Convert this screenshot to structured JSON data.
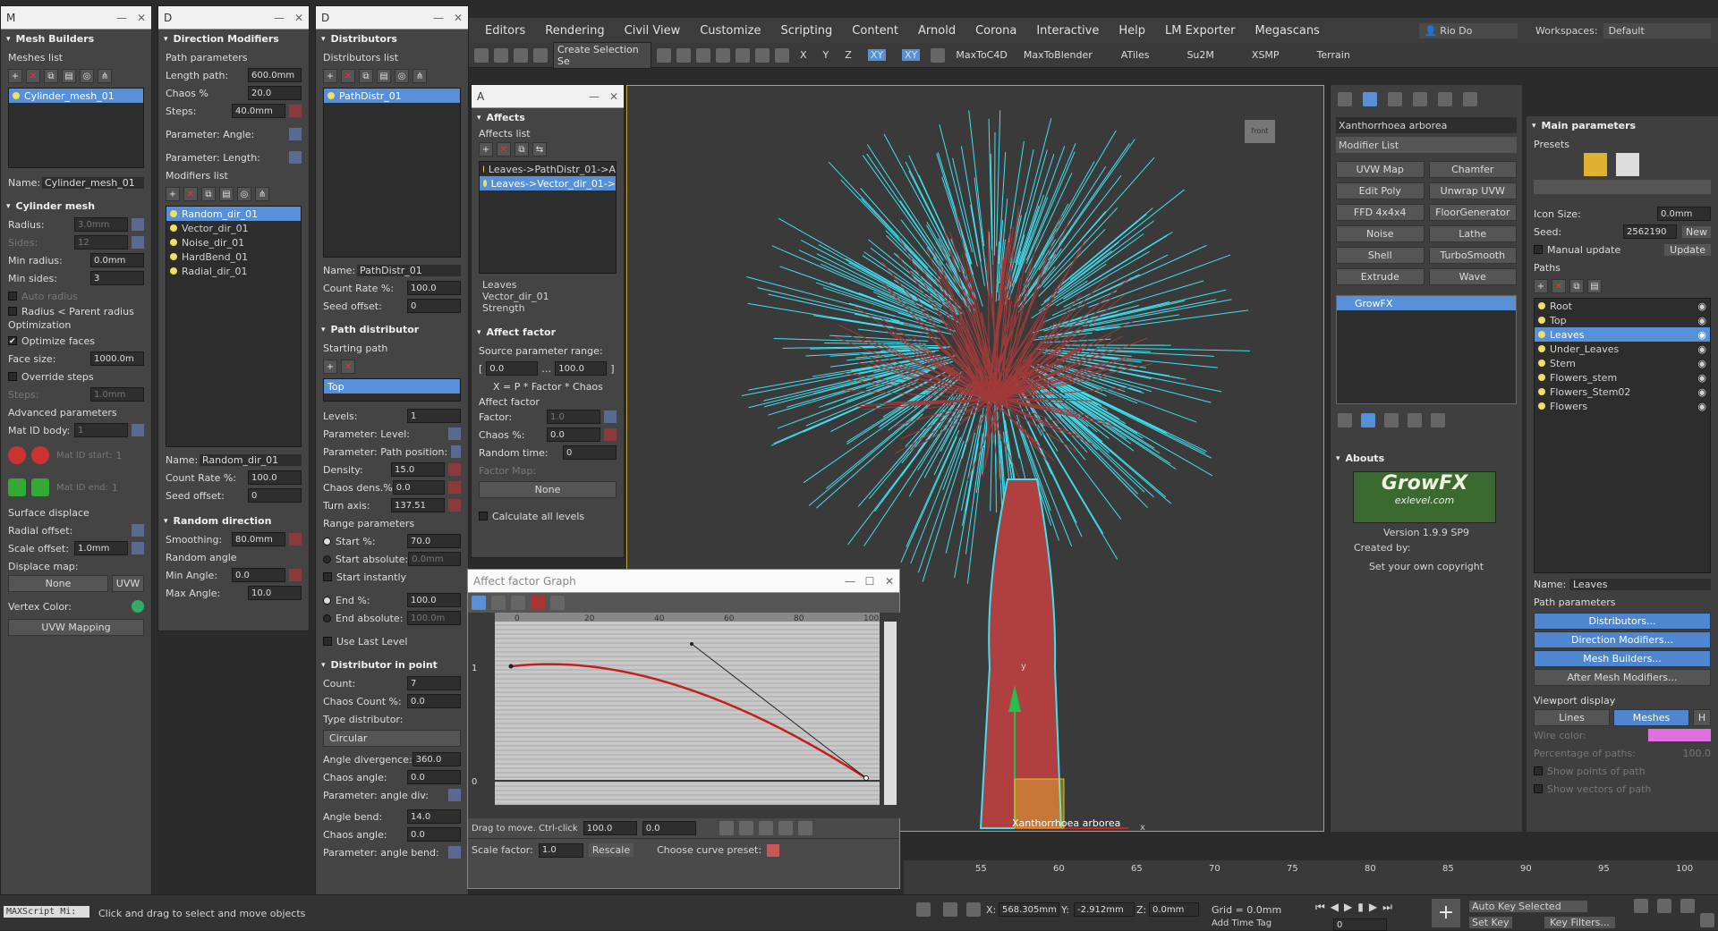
{
  "menu": {
    "items": [
      "Editors",
      "Rendering",
      "Civil View",
      "Customize",
      "Scripting",
      "Content",
      "Arnold",
      "Corona",
      "Interactive",
      "Help",
      "LM Exporter",
      "Megascans"
    ],
    "user": "Rio Do",
    "workspace_label": "Workspaces:",
    "workspace": "Default"
  },
  "toolbar": {
    "selection_set": "Create Selection Se",
    "axis_buttons": [
      "X",
      "Y",
      "Z",
      "XY",
      "XY"
    ],
    "plugins": [
      "MaxToC4D",
      "MaxToBlender",
      "ATiles",
      "Su2M",
      "XSMP",
      "Terrain"
    ]
  },
  "mesh_builders": {
    "window_title": "M",
    "header": "Mesh Builders",
    "list_label": "Meshes list",
    "items": [
      "Cylinder_mesh_01"
    ],
    "name_label": "Name:",
    "name_value": "Cylinder_mesh_01",
    "cyl_header": "Cylinder mesh",
    "radius_label": "Radius:",
    "radius": "3.0mm",
    "sides_label": "Sides:",
    "sides": "12",
    "min_radius_label": "Min radius:",
    "min_radius": "0.0mm",
    "min_sides_label": "Min sides:",
    "min_sides": "3",
    "auto_radius": "Auto radius",
    "radius_parent": "Radius < Parent radius",
    "optimization": "Optimization",
    "optimize_faces": "Optimize faces",
    "face_size_label": "Face size:",
    "face_size": "1000.0m",
    "override_steps": "Override steps",
    "steps_label": "Steps:",
    "steps": "1.0mm",
    "adv_params": "Advanced parameters",
    "mat_id_body_label": "Mat ID body:",
    "mat_id_body": "1",
    "mat_id_start_label": "Mat ID start:",
    "mat_id_start": "1",
    "mat_id_end_label": "Mat ID end:",
    "mat_id_end": "1",
    "surface_displace": "Surface displace",
    "radial_offset_label": "Radial offset:",
    "radial_offset": "",
    "scale_offset_label": "Scale offset:",
    "scale_offset": "1.0mm",
    "displace_map_label": "Displace map:",
    "displace_map": "None",
    "uvw": "UVW",
    "vertex_color_label": "Vertex Color:",
    "uvw_mapping": "UVW Mapping"
  },
  "direction_modifiers": {
    "window_title": "D",
    "header": "Direction Modifiers",
    "path_params": "Path parameters",
    "length_label": "Length path:",
    "length": "600.0mm",
    "chaos_label": "Chaos %",
    "chaos": "20.0",
    "steps_label": "Steps:",
    "steps": "40.0mm",
    "param_angle": "Parameter: Angle:",
    "param_length": "Parameter: Length:",
    "list_label": "Modifiers list",
    "items": [
      "Random_dir_01",
      "Vector_dir_01",
      "Noise_dir_01",
      "HardBend_01",
      "Radial_dir_01"
    ],
    "name_label": "Name:",
    "name_value": "Random_dir_01",
    "count_rate_label": "Count Rate %:",
    "count_rate": "100.0",
    "seed_label": "Seed offset:",
    "seed": "0",
    "random_header": "Random direction",
    "smoothing_label": "Smoothing:",
    "smoothing": "80.0mm",
    "random_angle": "Random angle",
    "min_angle_label": "Min Angle:",
    "min_angle": "0.0",
    "max_angle_label": "Max Angle:",
    "max_angle": "10.0"
  },
  "distributors": {
    "window_title": "D",
    "header": "Distributors",
    "list_label": "Distributors list",
    "items": [
      "PathDistr_01"
    ],
    "name_label": "Name:",
    "name_value": "PathDistr_01",
    "count_rate_label": "Count Rate %:",
    "count_rate": "100.0",
    "seed_label": "Seed offset:",
    "seed": "0",
    "path_dist": "Path distributor",
    "starting_path": "Starting path",
    "start_item": "Top",
    "levels_label": "Levels:",
    "levels": "1",
    "param_level": "Parameter: Level:",
    "param_path_pos": "Parameter: Path position:",
    "density_label": "Density:",
    "density": "15.0",
    "chaos_dens_label": "Chaos dens.%",
    "chaos_dens": "0.0",
    "turn_axis_label": "Turn axis:",
    "turn_axis": "137.51",
    "range_params": "Range parameters",
    "start_pct_label": "Start %:",
    "start_pct": "70.0",
    "start_abs_label": "Start absolute:",
    "start_abs": "0.0mm",
    "start_inst": "Start instantly",
    "end_pct_label": "End %:",
    "end_pct": "100.0",
    "end_abs_label": "End absolute:",
    "end_abs": "100.0m",
    "use_last": "Use Last Level",
    "dist_point": "Distributor in point",
    "count_label": "Count:",
    "count": "7",
    "chaos_count_label": "Chaos Count %:",
    "chaos_count": "0.0",
    "type_label": "Type distributor:",
    "type": "Circular",
    "angle_div_label": "Angle divergence:",
    "angle_div": "360.0",
    "chaos_angle_label": "Chaos angle:",
    "chaos_angle": "0.0",
    "param_angle_div": "Parameter: angle div:",
    "angle_bend_label": "Angle bend:",
    "angle_bend": "14.0",
    "chaos_angle2_label": "Chaos angle:",
    "chaos_angle2": "0.0",
    "param_angle_bend": "Parameter: angle bend:"
  },
  "affects": {
    "window_title": "A",
    "header": "Affects",
    "list_label": "Affects list",
    "items": [
      "Leaves->PathDistr_01->A",
      "Leaves->Vector_dir_01->"
    ],
    "info": [
      "Leaves",
      "Vector_dir_01",
      "Strength"
    ],
    "factor_header": "Affect factor",
    "source_range": "Source parameter range:",
    "range_a": "0.0",
    "range_b": "100.0",
    "formula": "X = P * Factor * Chaos",
    "affect_factor": "Affect factor",
    "factor_label": "Factor:",
    "factor": "1.0",
    "chaos_label": "Chaos %:",
    "chaos": "0.0",
    "random_time_label": "Random time:",
    "random_time": "0",
    "factor_map_label": "Factor Map:",
    "factor_map": "None",
    "calc_all": "Calculate all levels"
  },
  "graph": {
    "title": "Affect factor Graph",
    "ticks_x": [
      "0",
      "20",
      "40",
      "60",
      "80",
      "100"
    ],
    "ticks_y": [
      "1",
      "0"
    ],
    "status": "Drag to move. Ctrl-click",
    "val1": "100.0",
    "val2": "0.0",
    "scale_label": "Scale factor:",
    "scale": "1.0",
    "rescale": "Rescale",
    "preset_label": "Choose curve preset:"
  },
  "command_panel": {
    "object_name": "Xanthorrhoea arborea",
    "modifier_list": "Modifier List",
    "buttons": [
      "UVW Map",
      "Chamfer",
      "Edit Poly",
      "Unwrap UVW",
      "FFD 4x4x4",
      "FloorGenerator",
      "Noise",
      "Lathe",
      "Shell",
      "TurboSmooth",
      "Extrude",
      "Wave"
    ],
    "stack_item": "GrowFX",
    "abouts": "Abouts",
    "logo_text": "GrowFX",
    "logo_sub": "exlevel.com",
    "version": "Version 1.9.9 SP9",
    "created_by": "Created by:",
    "copyright": "Set your own copyright"
  },
  "growfx": {
    "header": "Main parameters",
    "presets": "Presets",
    "icon_size_label": "Icon Size:",
    "icon_size": "0.0mm",
    "seed_label": "Seed:",
    "seed": "2562190",
    "new": "New",
    "manual_update": "Manual update",
    "update": "Update",
    "paths_label": "Paths",
    "paths": [
      "Root",
      "Top",
      "Leaves",
      "Under_Leaves",
      "Stem",
      "Flowers_stem",
      "Flowers_Stem02",
      "Flowers"
    ],
    "name_label": "Name:",
    "name_value": "Leaves",
    "path_params": "Path parameters",
    "btn_distributors": "Distributors...",
    "btn_direction": "Direction Modifiers...",
    "btn_mesh": "Mesh Builders...",
    "btn_after": "After Mesh Modifiers...",
    "viewport_display": "Viewport display",
    "lines": "Lines",
    "meshes": "Meshes",
    "h": "H",
    "wire_color_label": "Wire color:",
    "pct_paths_label": "Percentage of paths:",
    "pct_paths": "100.0",
    "show_points": "Show points of path",
    "show_vectors": "Show vectors of path"
  },
  "viewport": {
    "label": "Xanthorrhoea arborea",
    "axis_x": "x",
    "axis_y": "y"
  },
  "status": {
    "maxscript": "MAXScript Mi:",
    "hint": "Click and drag to select and move objects",
    "x_label": "X:",
    "x": "568.305mm",
    "y_label": "Y:",
    "y": "-2.912mm",
    "z_label": "Z:",
    "z": "0.0mm",
    "grid": "Grid = 0.0mm",
    "add_time_tag": "Add Time Tag",
    "auto_key": "Auto Key",
    "selected": "Selected",
    "set_key": "Set Key",
    "key_filters": "Key Filters...",
    "frame": "0",
    "timeline_ticks": [
      "55",
      "60",
      "65",
      "70",
      "75",
      "80",
      "85",
      "90",
      "95",
      "100"
    ]
  },
  "colors": {
    "accent": "#5890d8",
    "leaf": "#40e0f0",
    "stem": "#b04040",
    "wire": "#e070e0"
  }
}
